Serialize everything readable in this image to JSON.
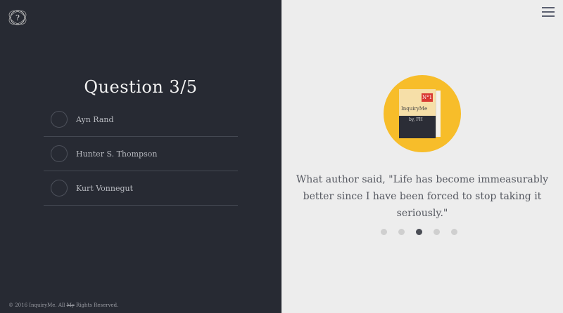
{
  "header": {
    "logo_glyph": "?"
  },
  "quiz": {
    "title": "Question 3/5",
    "options": [
      {
        "label": "Ayn Rand"
      },
      {
        "label": "Hunter S. Thompson"
      },
      {
        "label": "Kurt Vonnegut"
      }
    ]
  },
  "footer": {
    "text_before": "© 2016 InquiryMe. All ",
    "strike": "My",
    "text_after": " Rights Reserved."
  },
  "book": {
    "number": "N°1",
    "title": "InquiryMe",
    "by": "by, FH"
  },
  "question_text": "What author said, \"Life has become immeasurably better since I have been forced to stop taking it seriously.\"",
  "pagination": {
    "total": 5,
    "active_index": 2
  },
  "colors": {
    "left_panel": "#272a33",
    "right_panel": "#ededed",
    "badge": "#f7bd2a",
    "accent_red": "#d93a32"
  }
}
